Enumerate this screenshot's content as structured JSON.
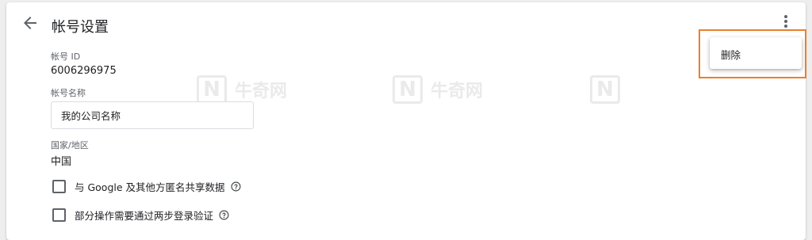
{
  "page": {
    "title": "帐号设置",
    "back_icon": "arrow-left-icon",
    "more_icon": "more-vert-icon"
  },
  "fields": {
    "account_id_label": "帐号 ID",
    "account_id_value": "6006296975",
    "account_name_label": "帐号名称",
    "account_name_value": "我的公司名称",
    "country_label": "国家/地区",
    "country_value": "中国"
  },
  "options": {
    "share_data_label": "与 Google 及其他方匿名共享数据",
    "share_data_checked": false,
    "two_step_label": "部分操作需要通过两步登录验证",
    "two_step_checked": false,
    "help_icon": "help-circle-icon"
  },
  "menu": {
    "delete_label": "删除"
  },
  "watermark": {
    "text": "牛奇网",
    "logo_letter": "N"
  },
  "colors": {
    "highlight": "#e8802f",
    "text": "#202124",
    "secondary_text": "#5f6368",
    "border": "#dadce0"
  }
}
